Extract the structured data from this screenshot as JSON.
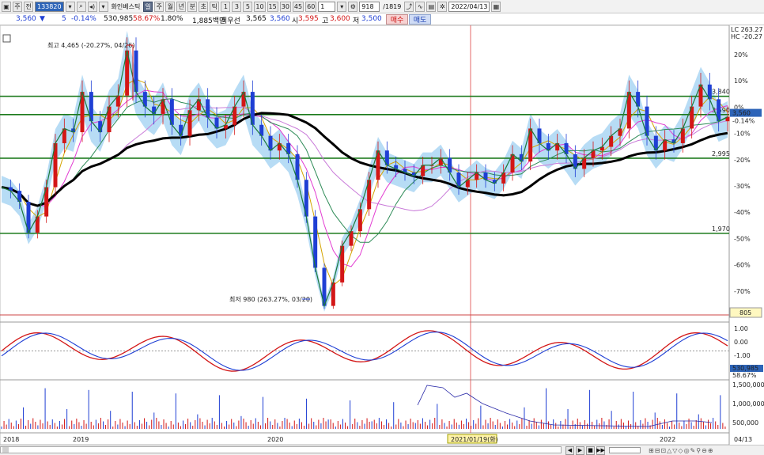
{
  "toolbar": {
    "market": "주",
    "period_select": "전",
    "stock_code": "133820",
    "stock_name": "화인베스틱",
    "period_buttons": [
      "일",
      "주",
      "월",
      "년",
      "분",
      "초",
      "틱"
    ],
    "active_period": "일",
    "interval_buttons": [
      "1",
      "3",
      "5",
      "10",
      "15",
      "30",
      "45",
      "60"
    ],
    "interval_value": "1",
    "count": "918",
    "count_total": "/1819",
    "date": "2022/04/13"
  },
  "quote": {
    "price": "3,560",
    "change": "5",
    "change_pct": "-0.14%",
    "volume": "530,985",
    "turnover_pct": "58.67%",
    "ratio": "1.80%",
    "amount": "1,885백만",
    "preferred_label": "최우선",
    "best_ask": "3,565",
    "best_bid": "3,560",
    "open_label": "시",
    "open": "3,595",
    "high_label": "고",
    "high": "3,600",
    "low_label": "저",
    "low": "3,500",
    "buy": "매수",
    "sell": "매도"
  },
  "chart_data": {
    "type": "line",
    "title": "",
    "x_labels": [
      "2018",
      "2019",
      "2020",
      "2021/01/19(화)",
      "2022",
      "04/13"
    ],
    "y_pct_ticks": [
      "20%",
      "10%",
      "0%",
      "-10%",
      "-20%",
      "-30%",
      "-40%",
      "-50%",
      "-60%",
      "-70%"
    ],
    "legend": [
      "LC 263.27",
      "HC -20.27"
    ],
    "horizontal_levels": [
      3840,
      3590,
      2995,
      1970
    ],
    "horizontal_level_labels": [
      "3,840",
      "3,590",
      "2,995",
      "1,970"
    ],
    "current_price_label": "3,560",
    "current_change_label": "-0.14%",
    "high_annotation": "최고 4,465 (-20.27%, 04/26)",
    "low_annotation": "최저 980 (263.27%, 03/20)",
    "side_badge": "805",
    "oscillator_ticks": [
      "1.00",
      "0.00",
      "-1.00"
    ],
    "volume_labels": [
      "530,985",
      "58.67%"
    ],
    "obv_ticks": [
      "1,500,000",
      "1,000,000",
      "500,000"
    ],
    "price_series": [
      2600,
      2550,
      2400,
      1980,
      2200,
      2600,
      3200,
      3400,
      3350,
      3900,
      3500,
      3350,
      3700,
      3850,
      4465,
      3900,
      3700,
      3600,
      3800,
      3450,
      3300,
      3650,
      3800,
      3550,
      3400,
      3450,
      3700,
      3900,
      3450,
      3300,
      3100,
      3200,
      3050,
      2700,
      2200,
      1500,
      980,
      1300,
      1800,
      2000,
      2300,
      2700,
      3100,
      2900,
      2850,
      2800,
      2750,
      2900,
      2900,
      3000,
      2800,
      2600,
      2700,
      2800,
      2700,
      2650,
      2800,
      3050,
      2950,
      3400,
      3200,
      3100,
      3200,
      3050,
      2850,
      3000,
      3100,
      3150,
      3300,
      3400,
      3900,
      3700,
      3300,
      3100,
      3250,
      3200,
      3400,
      3700,
      4000,
      3800,
      3500,
      3560
    ]
  },
  "status": {
    "controls": [
      "◀",
      "▶",
      "■",
      "▶▶"
    ]
  }
}
